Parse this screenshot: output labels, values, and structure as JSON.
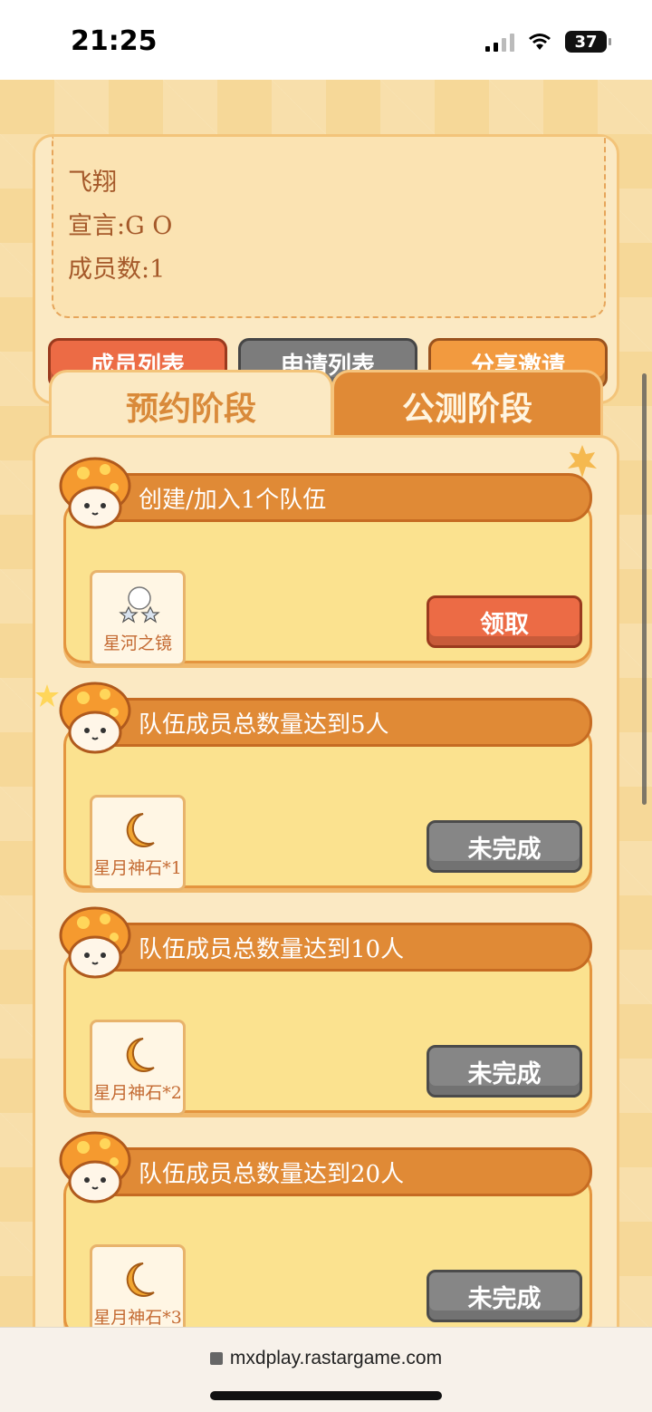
{
  "status_bar": {
    "time": "21:25",
    "battery": "37"
  },
  "team": {
    "name": "飞翔",
    "declaration": "宣言:G O",
    "members": "成员数:1",
    "buttons": [
      "成员列表",
      "申请列表",
      "分享邀请"
    ]
  },
  "tabs": [
    {
      "label": "预约阶段",
      "active": true
    },
    {
      "label": "公测阶段",
      "active": false
    }
  ],
  "tasks": [
    {
      "title": "创建/加入1个队伍",
      "reward": "星河之镜",
      "reward_icon": "glasses-icon",
      "button": "领取",
      "state": "claimable"
    },
    {
      "title": "队伍成员总数量达到5人",
      "reward": "星月神石*1",
      "reward_icon": "moon-stone-icon",
      "button": "未完成",
      "state": "incomplete"
    },
    {
      "title": "队伍成员总数量达到10人",
      "reward": "星月神石*2",
      "reward_icon": "moon-stone-icon",
      "button": "未完成",
      "state": "incomplete"
    },
    {
      "title": "队伍成员总数量达到20人",
      "reward": "星月神石*3",
      "reward_icon": "moon-stone-icon",
      "button": "未完成",
      "state": "incomplete"
    }
  ],
  "browser": {
    "url": "mxdplay.rastargame.com"
  },
  "colors": {
    "accent": "#e08a36",
    "claim": "#ec6b45",
    "disabled": "#868686"
  }
}
